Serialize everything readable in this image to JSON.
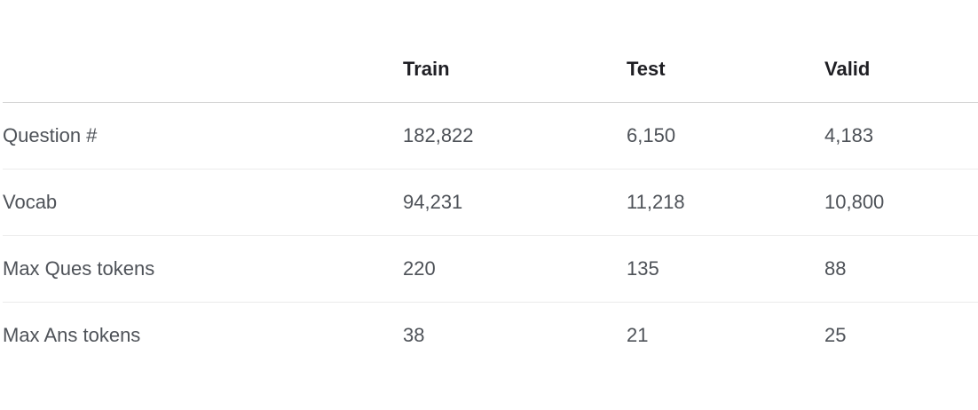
{
  "table": {
    "headers": [
      "",
      "Train",
      "Test",
      "Valid"
    ],
    "rows": [
      [
        "Question #",
        "182,822",
        "6,150",
        "4,183"
      ],
      [
        "Vocab",
        "94,231",
        "11,218",
        "10,800"
      ],
      [
        "Max Ques tokens",
        "220",
        "135",
        "88"
      ],
      [
        "Max Ans tokens",
        "38",
        "21",
        "25"
      ]
    ]
  }
}
